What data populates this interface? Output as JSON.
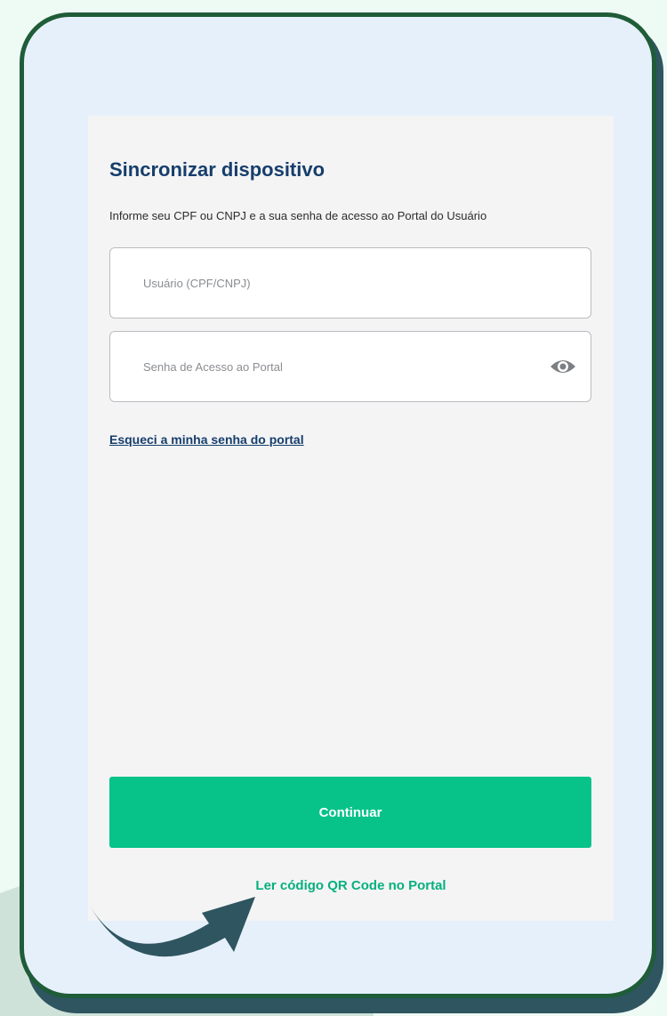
{
  "form": {
    "title": "Sincronizar dispositivo",
    "subtitle": "Informe seu CPF ou CNPJ e a sua senha de acesso ao Portal do Usuário",
    "user_placeholder": "Usuário (CPF/CNPJ)",
    "password_placeholder": "Senha de Acesso ao Portal",
    "forgot_link": "Esqueci a minha senha do portal",
    "continue_label": "Continuar",
    "qr_link": "Ler código QR Code no Portal"
  },
  "icons": {
    "password_toggle": "eye-icon",
    "annotation": "curved-arrow-icon"
  },
  "colors": {
    "accent": "#07c389",
    "heading": "#163e6b",
    "frame_border": "#1f5c38"
  }
}
